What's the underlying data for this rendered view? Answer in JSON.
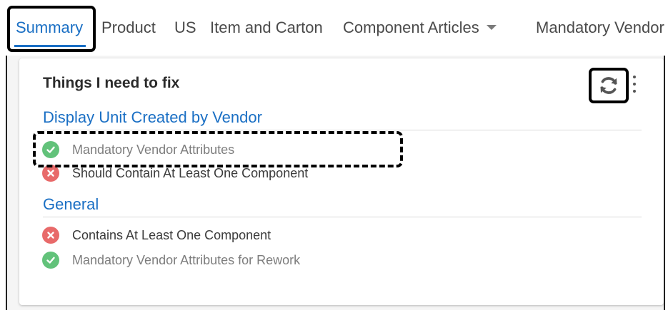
{
  "tabs": [
    {
      "label": "Summary",
      "active": true
    },
    {
      "label": "Product"
    },
    {
      "label": "US"
    },
    {
      "label": "Item and Carton"
    },
    {
      "label": "Component Articles",
      "has_dropdown": true
    },
    {
      "label": "Mandatory Vendor"
    }
  ],
  "card": {
    "title": "Things I need to fix",
    "refresh_icon": "refresh-icon",
    "menu_icon": "more-vertical-icon",
    "sections": [
      {
        "title": "Display Unit Created by Vendor",
        "items": [
          {
            "label": "Mandatory Vendor Attributes",
            "status": "pass",
            "icon": "check-circle-icon"
          },
          {
            "label": "Should Contain At Least One Component",
            "status": "fail",
            "icon": "x-circle-icon"
          }
        ]
      },
      {
        "title": "General",
        "items": [
          {
            "label": "Contains At Least One Component",
            "status": "fail",
            "icon": "x-circle-icon"
          },
          {
            "label": "Mandatory Vendor Attributes for Rework",
            "status": "pass",
            "icon": "check-circle-icon"
          }
        ]
      }
    ]
  },
  "colors": {
    "accent": "#1a6fc4",
    "pass": "#62c27a",
    "fail": "#e86a6a"
  }
}
